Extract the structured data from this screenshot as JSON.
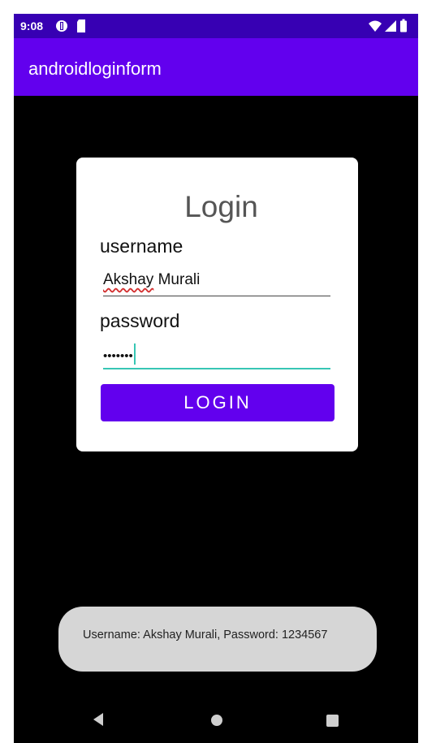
{
  "status_bar": {
    "time": "9:08",
    "icons": [
      "data-saver-icon",
      "sd-card-icon",
      "wifi-icon",
      "signal-icon",
      "battery-icon"
    ]
  },
  "app_bar": {
    "title": "androidloginform"
  },
  "login_card": {
    "title": "Login",
    "username_label": "username",
    "username_value_part1": "Akshay",
    "username_value_part2": " Murali",
    "password_label": "password",
    "password_masked": "•••••••",
    "login_button": "LOGIN"
  },
  "toast": {
    "text": "Username: Akshay Murali, Password: 1234567"
  },
  "nav_bar": {
    "items": [
      "back-icon",
      "home-icon",
      "recents-icon"
    ]
  },
  "colors": {
    "status_bar": "#3700b3",
    "primary": "#6200ee",
    "accent": "#37c6b4",
    "background": "#000000",
    "toast": "#d6d6d6"
  }
}
